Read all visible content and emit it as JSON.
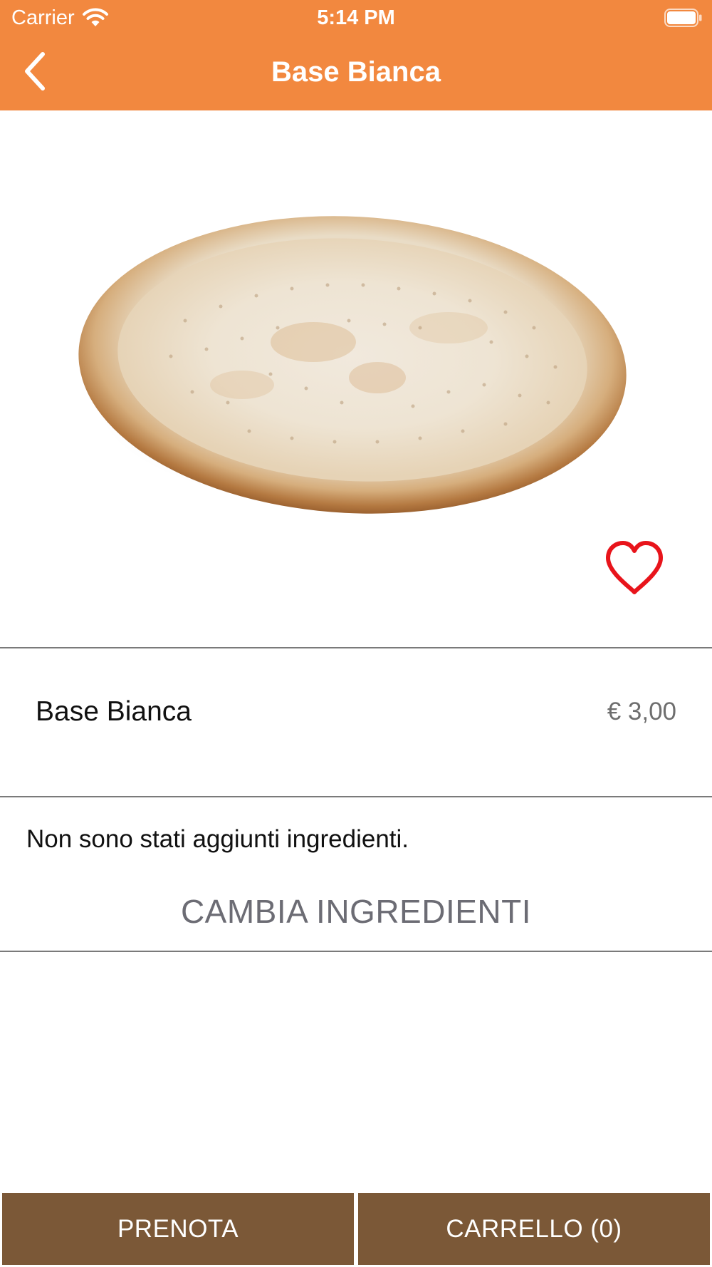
{
  "status_bar": {
    "carrier": "Carrier",
    "time": "5:14 PM",
    "wifi_icon": "wifi-icon",
    "battery_icon": "battery-icon"
  },
  "nav": {
    "title": "Base Bianca",
    "back_icon": "chevron-left-icon"
  },
  "hero": {
    "image": "pizza-base-image",
    "favorite_icon": "heart-outline-icon"
  },
  "product": {
    "name": "Base Bianca",
    "price": "€ 3,00"
  },
  "ingredients": {
    "note": "Non sono stati aggiunti ingredienti.",
    "change_label": "CAMBIA INGREDIENTI"
  },
  "actions": {
    "prenota_label": "PRENOTA",
    "carrello_label": "CARRELLO (0)"
  },
  "colors": {
    "header": "#F2883F",
    "button": "#7B5837",
    "heart": "#E8141B"
  }
}
